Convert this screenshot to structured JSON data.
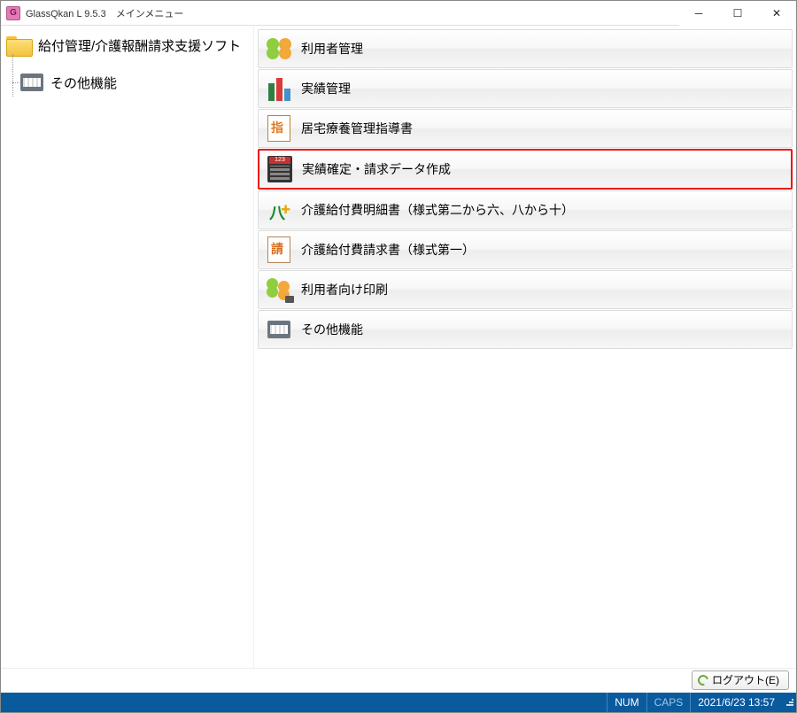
{
  "window": {
    "title": "GlassQkan L 9.5.3　メインメニュー",
    "app_icon_letter": "G",
    "buttons": {
      "min": "─",
      "max": "☐",
      "close": "✕"
    }
  },
  "tree": {
    "root_label": "給付管理/介護報酬請求支援ソフト",
    "child_label": "その他機能"
  },
  "menu": [
    {
      "label": "利用者管理",
      "icon": "users-icon"
    },
    {
      "label": "実績管理",
      "icon": "bars-icon"
    },
    {
      "label": "居宅療養管理指導書",
      "icon": "guidance-doc-icon"
    },
    {
      "label": "実績確定・請求データ作成",
      "icon": "calculator-icon",
      "highlighted": true
    },
    {
      "label": "介護給付費明細書（様式第二から六、八から十）",
      "icon": "care-detail-icon"
    },
    {
      "label": "介護給付費請求書（様式第一）",
      "icon": "invoice-doc-icon"
    },
    {
      "label": "利用者向け印刷",
      "icon": "users-print-icon"
    },
    {
      "label": "その他機能",
      "icon": "cabinet-icon"
    }
  ],
  "toolbar": {
    "logout_label": "ログアウト(E)"
  },
  "status": {
    "num": "NUM",
    "caps": "CAPS",
    "datetime": "2021/6/23 13:57"
  }
}
